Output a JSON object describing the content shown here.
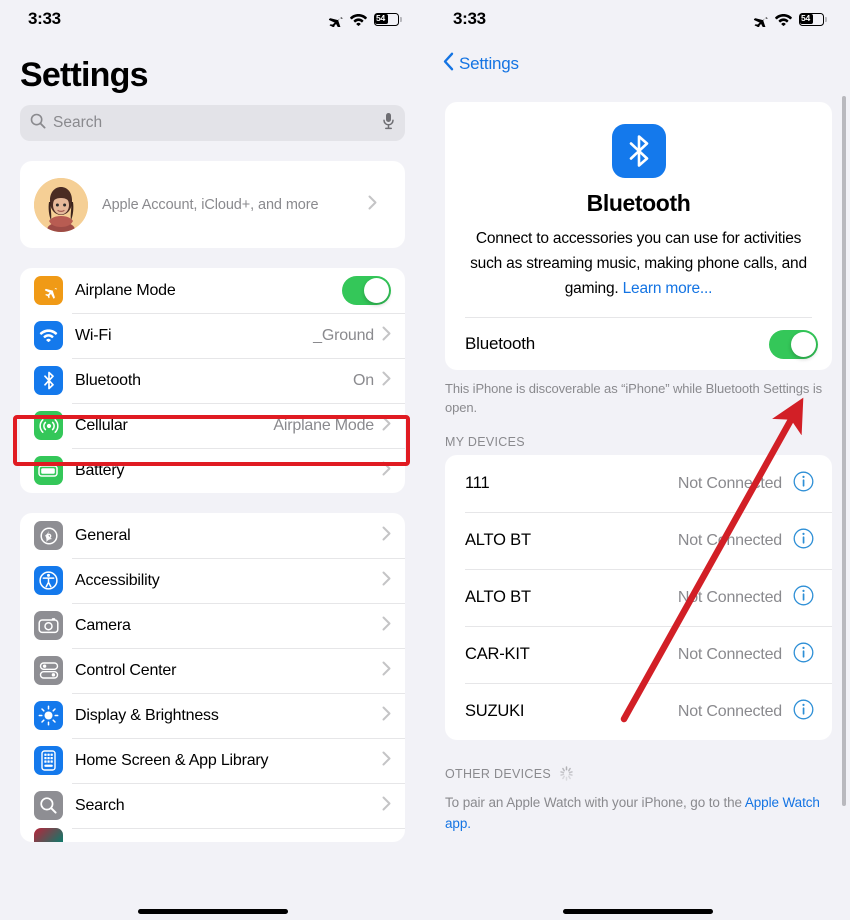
{
  "status_bar": {
    "time": "3:33",
    "icons": [
      "airplane-icon",
      "wifi-icon",
      "battery-icon"
    ],
    "battery_level": "54"
  },
  "left_panel": {
    "title": "Settings",
    "search": {
      "placeholder": "Search",
      "value": "",
      "mic_icon": "microphone-icon"
    },
    "account": {
      "subtitle": "Apple Account, iCloud+, and more",
      "avatar": "memoji-avatar"
    },
    "group_1": [
      {
        "label": "Airplane Mode",
        "icon": "airplane-icon",
        "icon_color": "#f09a16",
        "control": "toggle",
        "toggle_on": true
      },
      {
        "label": "Wi-Fi",
        "icon": "wifi-icon",
        "icon_color": "#1479ec",
        "value": "_Ground",
        "control": "chevron"
      },
      {
        "label": "Bluetooth",
        "icon": "bluetooth-icon",
        "icon_color": "#1479ec",
        "value": "On",
        "control": "chevron",
        "highlighted": true
      },
      {
        "label": "Cellular",
        "icon": "cellular-icon",
        "icon_color": "#34c759",
        "value": "Airplane Mode",
        "control": "chevron"
      },
      {
        "label": "Battery",
        "icon": "battery-icon",
        "icon_color": "#34c759",
        "value": "",
        "control": "chevron"
      }
    ],
    "group_2": [
      {
        "label": "General",
        "icon": "gear-icon",
        "icon_color": "#8e8e93",
        "control": "chevron"
      },
      {
        "label": "Accessibility",
        "icon": "accessibility-icon",
        "icon_color": "#1479ec",
        "control": "chevron"
      },
      {
        "label": "Camera",
        "icon": "camera-icon",
        "icon_color": "#8e8e93",
        "control": "chevron"
      },
      {
        "label": "Control Center",
        "icon": "control-center-icon",
        "icon_color": "#8e8e93",
        "control": "chevron"
      },
      {
        "label": "Display & Brightness",
        "icon": "brightness-icon",
        "icon_color": "#1479ec",
        "control": "chevron"
      },
      {
        "label": "Home Screen & App Library",
        "icon": "home-screen-icon",
        "icon_color": "#1479ec",
        "control": "chevron"
      },
      {
        "label": "Search",
        "icon": "search-icon",
        "icon_color": "#8e8e93",
        "control": "chevron"
      }
    ]
  },
  "right_panel": {
    "back_label": "Settings",
    "bluetooth": {
      "app_icon": "bluetooth-icon",
      "title": "Bluetooth",
      "description": "Connect to accessories you can use for activities such as streaming music, making phone calls, and gaming. ",
      "learn_more": "Learn more...",
      "toggle_label": "Bluetooth",
      "toggle_on": true,
      "footnote": "This iPhone is discoverable as “iPhone” while Bluetooth Settings is open."
    },
    "my_devices_header": "MY DEVICES",
    "devices": [
      {
        "name": "111",
        "status": "Not Connected",
        "info_icon": "info-icon"
      },
      {
        "name": "ALTO BT",
        "status": "Not Connected",
        "info_icon": "info-icon"
      },
      {
        "name": "ALTO BT",
        "status": "Not Connected",
        "info_icon": "info-icon"
      },
      {
        "name": "CAR-KIT",
        "status": "Not Connected",
        "info_icon": "info-icon"
      },
      {
        "name": "SUZUKI",
        "status": "Not Connected",
        "info_icon": "info-icon"
      }
    ],
    "other_devices_header": "OTHER DEVICES",
    "other_devices_spinner": "loading-spinner-icon",
    "pair_note": "To pair an Apple Watch with your iPhone, go to the ",
    "pair_note_link": "Apple Watch app."
  },
  "annotations": {
    "highlight_color": "#e01b22",
    "arrow_color": "#d21f26",
    "highlight_target": "bluetooth-settings-row",
    "arrow_target": "bluetooth-toggle"
  }
}
